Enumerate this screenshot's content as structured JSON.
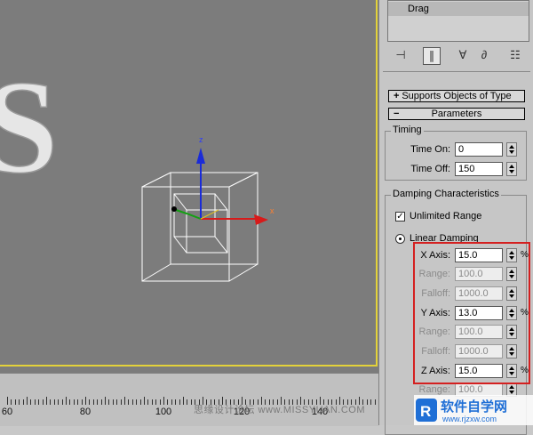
{
  "viewport": {
    "text_object": "S",
    "gizmo": {
      "z_label": "z",
      "x_label": "x"
    }
  },
  "timeline": {
    "labels": [
      "60",
      "80",
      "100",
      "120",
      "140"
    ]
  },
  "watermark": "思缘设计论坛 www.MISSYUAN.COM",
  "panel": {
    "object_type_row": "Drag",
    "toolbar": [
      {
        "icon": "pin-stack-icon",
        "label": "⊣"
      },
      {
        "icon": "modifier-pipe-icon",
        "label": "∥"
      },
      {
        "icon": "show-result-icon",
        "label": "∀"
      },
      {
        "icon": "unique-icon",
        "label": "∂"
      },
      {
        "icon": "configure-icon",
        "label": "☷"
      }
    ],
    "rollouts": {
      "supports": {
        "sign": "+",
        "label": "Supports Objects of Type"
      },
      "parameters": {
        "sign": "−",
        "label": "Parameters"
      }
    },
    "timing": {
      "title": "Timing",
      "time_on_label": "Time On:",
      "time_on_value": "0",
      "time_off_label": "Time Off:",
      "time_off_value": "150"
    },
    "damping": {
      "title": "Damping Characteristics",
      "unlimited_range_label": "Unlimited Range",
      "unlimited_range_checked": true,
      "linear_damping_label": "Linear Damping",
      "pct": "%",
      "rows": [
        {
          "label": "X Axis:",
          "value": "15.0"
        },
        {
          "label": "Range:",
          "value": "100.0"
        },
        {
          "label": "Falloff:",
          "value": "1000.0"
        },
        {
          "label": "Y Axis:",
          "value": "13.0"
        },
        {
          "label": "Range:",
          "value": "100.0"
        },
        {
          "label": "Falloff:",
          "value": "1000.0"
        },
        {
          "label": "Z Axis:",
          "value": "15.0"
        },
        {
          "label": "Range:",
          "value": "100.0"
        }
      ]
    }
  },
  "logo": {
    "brand": "软件自学网",
    "url": "www.rjzxw.com"
  },
  "colors": {
    "viewport_bg": "#7c7c7c",
    "frame": "#e3d23a",
    "highlight": "#d42020",
    "logo_blue": "#1f6fd6"
  }
}
